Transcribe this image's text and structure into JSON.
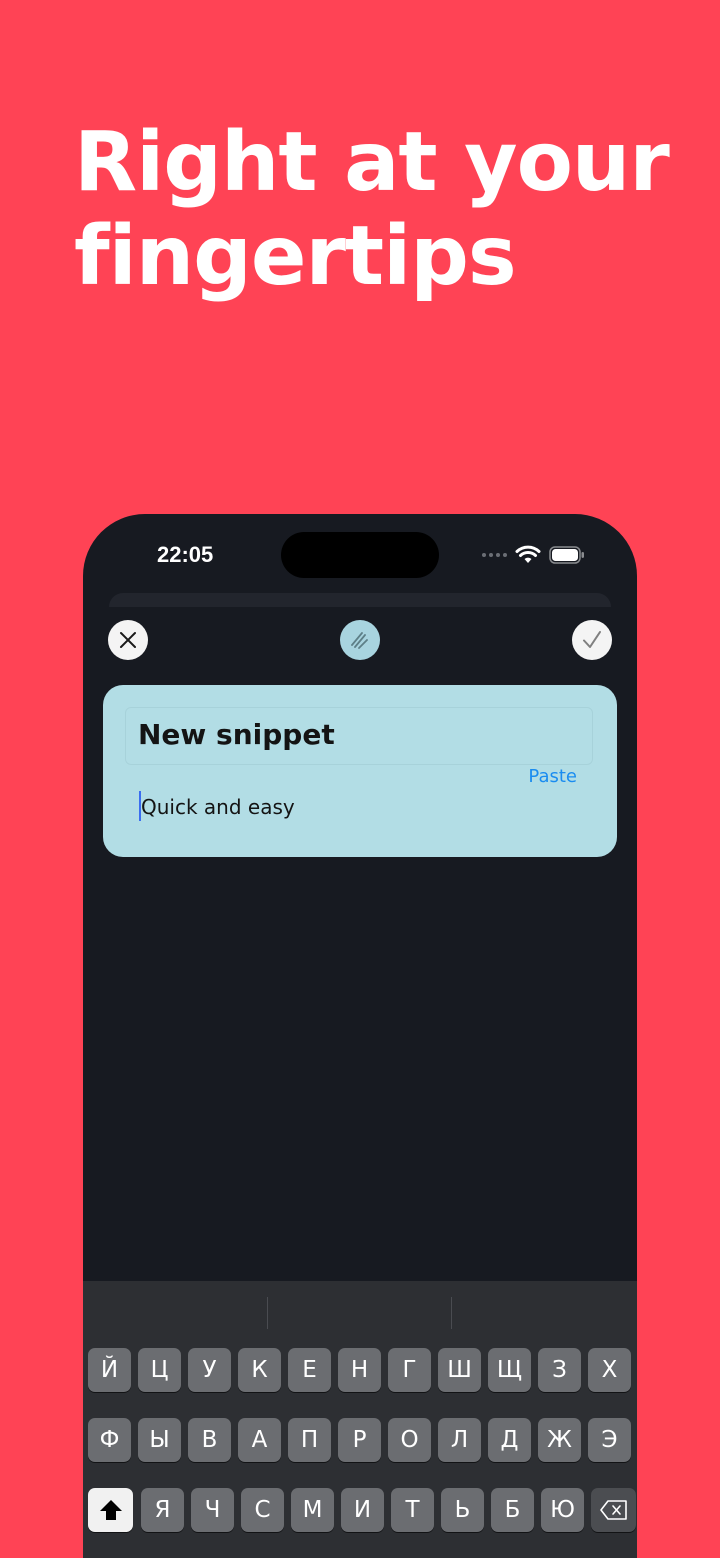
{
  "headline": {
    "line1": "Right at your",
    "line2": "fingertips"
  },
  "status_bar": {
    "time": "22:05",
    "icons": [
      "signal-dots-icon",
      "wifi-icon",
      "battery-icon"
    ]
  },
  "toolbar": {
    "close_icon": "close-icon",
    "mode_icon": "scribble-icon",
    "done_icon": "checkmark-icon"
  },
  "snippet_card": {
    "title": "New snippet",
    "paste_label": "Paste",
    "body": "Quick and easy",
    "background_color": "#b2dde5"
  },
  "keyboard": {
    "row1": [
      "Й",
      "Ц",
      "У",
      "К",
      "Е",
      "Н",
      "Г",
      "Ш",
      "Щ",
      "З",
      "Х"
    ],
    "row2": [
      "Ф",
      "Ы",
      "В",
      "А",
      "П",
      "Р",
      "О",
      "Л",
      "Д",
      "Ж",
      "Э"
    ],
    "row3": [
      "Я",
      "Ч",
      "С",
      "М",
      "И",
      "Т",
      "Ь",
      "Б",
      "Ю"
    ],
    "shift_icon": "shift-icon",
    "delete_icon": "delete-icon"
  },
  "colors": {
    "page_background": "#ff4355",
    "phone_background": "#171a21",
    "accent": "#1a8cf0"
  }
}
